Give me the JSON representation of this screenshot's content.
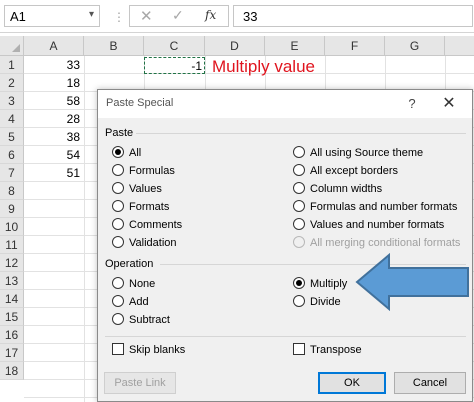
{
  "formula_bar": {
    "name_box": "A1",
    "separator": "⋮",
    "formula_value": "33",
    "icons": {
      "cancel": "✕",
      "enter": "✓",
      "fx": "fx",
      "dropdown": "▾"
    }
  },
  "sheet": {
    "columns": [
      "A",
      "B",
      "C",
      "D",
      "E",
      "F",
      "G"
    ],
    "rows": [
      "1",
      "2",
      "3",
      "4",
      "5",
      "6",
      "7",
      "8",
      "9",
      "10",
      "11",
      "12",
      "13",
      "14",
      "15",
      "16",
      "17",
      "18"
    ],
    "column_a_values": [
      "33",
      "18",
      "58",
      "28",
      "38",
      "54",
      "51"
    ],
    "c1_value": "-1",
    "annotation": "Multiply value"
  },
  "dialog": {
    "title": "Paste Special",
    "help": "?",
    "close": "✕",
    "paste_section": "Paste",
    "paste_left": [
      "All",
      "Formulas",
      "Values",
      "Formats",
      "Comments",
      "Validation"
    ],
    "paste_right": [
      "All using Source theme",
      "All except borders",
      "Column widths",
      "Formulas and number formats",
      "Values and number formats",
      "All merging conditional formats"
    ],
    "paste_selected": "All",
    "operation_section": "Operation",
    "operation_left": [
      "None",
      "Add",
      "Subtract"
    ],
    "operation_right": [
      "Multiply",
      "Divide"
    ],
    "operation_selected": "Multiply",
    "skip_blanks": "Skip blanks",
    "transpose": "Transpose",
    "paste_link": "Paste Link",
    "ok": "OK",
    "cancel": "Cancel"
  },
  "colors": {
    "annotation": "#e0141e",
    "arrow_fill": "#5b9bd5",
    "arrow_stroke": "#41719c",
    "selection_border": "#217346"
  }
}
